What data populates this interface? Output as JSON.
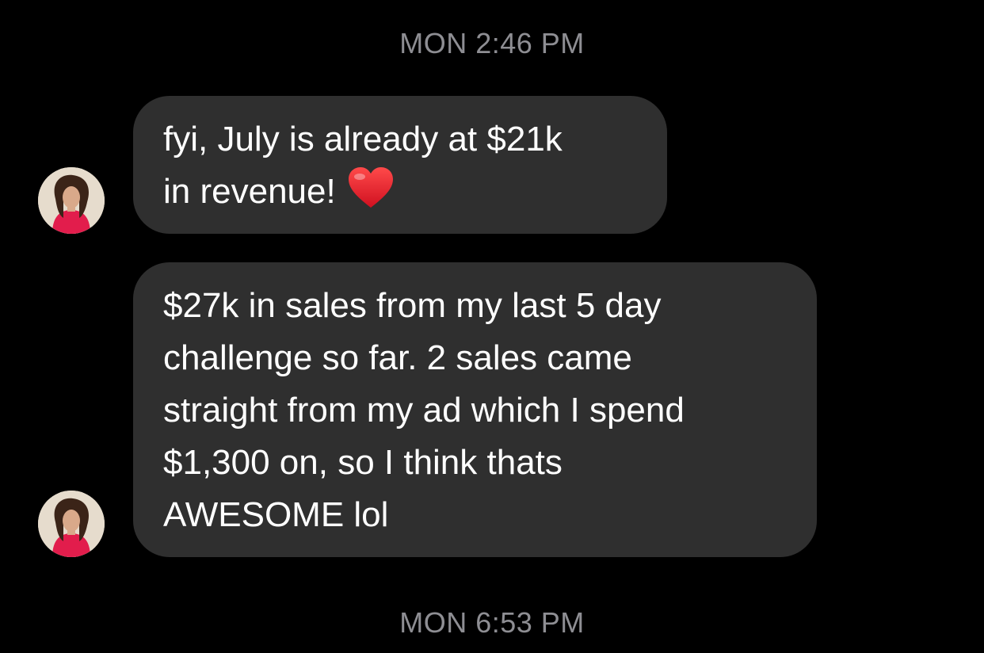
{
  "conversation": {
    "timestamps": [
      "MON 2:46 PM",
      "MON 6:53 PM"
    ],
    "messages": [
      {
        "sender": "incoming",
        "avatar_icon": "contact-avatar",
        "lines": [
          "fyi, July is already at $21k",
          "in revenue!"
        ],
        "emoji": "red-heart-emoji"
      },
      {
        "sender": "incoming",
        "avatar_icon": "contact-avatar",
        "lines": [
          "$27k in sales from my last 5 day",
          "challenge so far. 2 sales came",
          "straight from my ad which I spend",
          "$1,300 on, so I think thats",
          "AWESOME lol"
        ]
      }
    ]
  },
  "colors": {
    "background": "#000000",
    "bubble": "#2f2f2f",
    "timestamp_text": "#8e8e93",
    "message_text": "#ffffff",
    "heart": "#e0202e"
  }
}
